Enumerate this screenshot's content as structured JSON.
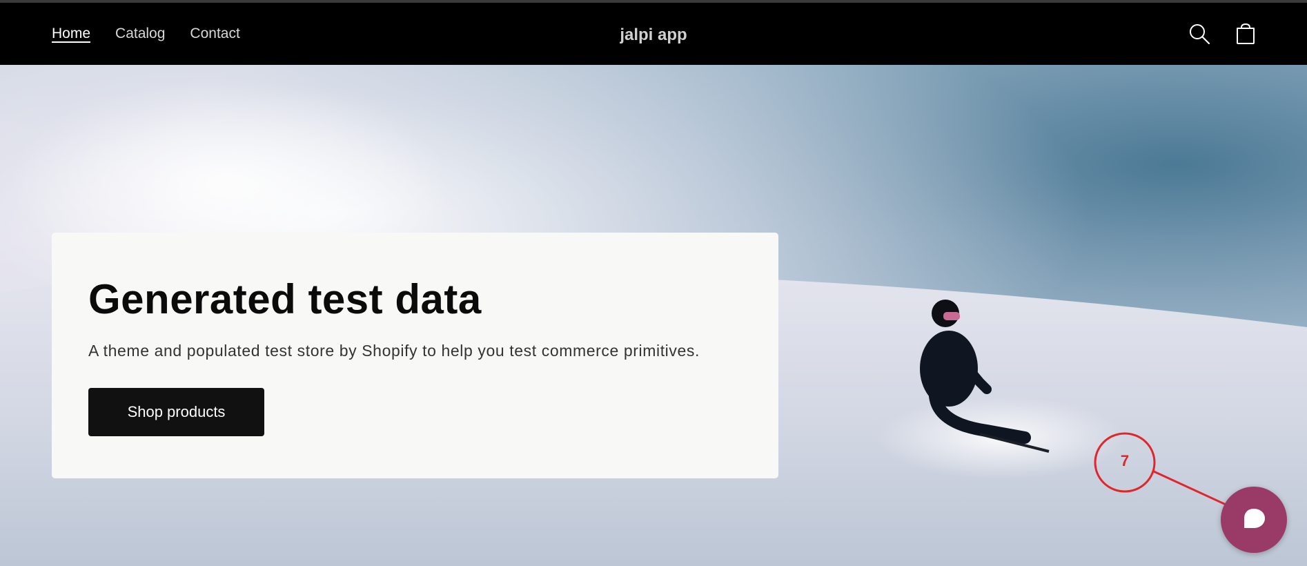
{
  "header": {
    "nav": [
      {
        "label": "Home",
        "active": true
      },
      {
        "label": "Catalog",
        "active": false
      },
      {
        "label": "Contact",
        "active": false
      }
    ],
    "brand": "jalpi app",
    "icons": {
      "search": "search-icon",
      "cart": "cart-icon"
    }
  },
  "hero": {
    "title": "Generated test data",
    "subtitle": "A theme and populated test store by Shopify to help you test commerce primitives.",
    "cta_label": "Shop products"
  },
  "annotation": {
    "label": "7",
    "color": "#e0262a"
  },
  "chat": {
    "icon": "chat-bubble-icon",
    "color": "#9a3a66"
  }
}
